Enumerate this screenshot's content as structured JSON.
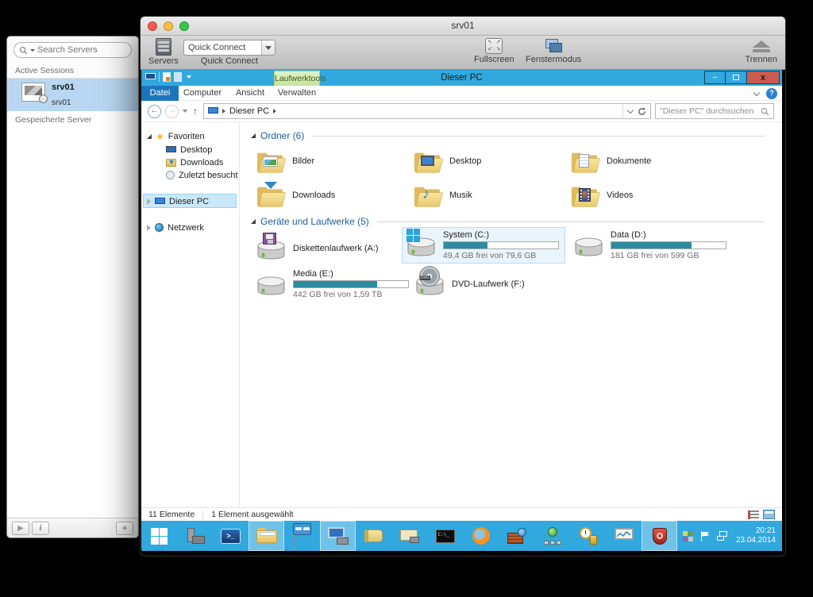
{
  "client": {
    "title": "srv01",
    "sidebar": {
      "search_placeholder": "Search Servers",
      "active_sessions_label": "Active Sessions",
      "saved_servers_label": "Gespeicherte Server",
      "session_name": "srv01",
      "session_subtitle": "srv01"
    },
    "toolbar": {
      "servers_label": "Servers",
      "quick_connect_value": "Quick Connect",
      "quick_connect_caption": "Quick Connect",
      "fullscreen_label": "Fullscreen",
      "window_mode_label": "Fenstermodus",
      "disconnect_label": "Trennen"
    }
  },
  "explorer": {
    "window_title": "Dieser PC",
    "contextual_tab": "Laufwerktools",
    "tabs": {
      "file": "Datei",
      "computer": "Computer",
      "view": "Ansicht",
      "manage": "Verwalten"
    },
    "breadcrumb_root": "Dieser PC",
    "search_placeholder": "\"Dieser PC\" durchsuchen",
    "nav": {
      "favorites": "Favoriten",
      "desktop": "Desktop",
      "downloads": "Downloads",
      "recent": "Zuletzt besucht",
      "this_pc": "Dieser PC",
      "network": "Netzwerk"
    },
    "folders_header": "Ordner (6)",
    "folders": [
      {
        "name": "Bilder"
      },
      {
        "name": "Desktop"
      },
      {
        "name": "Dokumente"
      },
      {
        "name": "Downloads"
      },
      {
        "name": "Musik"
      },
      {
        "name": "Videos"
      }
    ],
    "drives_header": "Geräte und Laufwerke (5)",
    "drives": [
      {
        "name": "Diskettenlaufwerk (A:)",
        "kind": "floppy"
      },
      {
        "name": "System (C:)",
        "free_text": "49,4 GB frei von 79,6 GB",
        "used_pct": 38,
        "kind": "system",
        "selected": true
      },
      {
        "name": "Data (D:)",
        "free_text": "181 GB frei von 599 GB",
        "used_pct": 70,
        "kind": "hdd"
      },
      {
        "name": "Media (E:)",
        "free_text": "442 GB frei von 1,59 TB",
        "used_pct": 73,
        "kind": "hdd"
      },
      {
        "name": "DVD-Laufwerk (F:)",
        "kind": "dvd"
      }
    ],
    "status": {
      "items": "11 Elemente",
      "selected": "1 Element ausgewählt"
    }
  },
  "taskbar": {
    "time": "20:21",
    "date": "23.04.2014",
    "icons": [
      "start",
      "server-manager",
      "powershell",
      "file-explorer",
      "display-settings",
      "computer-management",
      "help-book",
      "scroll-tools",
      "command-prompt",
      "firefox",
      "firewall",
      "network-tree",
      "time-service",
      "performance-monitor",
      "security-shield"
    ],
    "tray_icons": [
      "app-badge",
      "action-center-flag",
      "network-status"
    ]
  },
  "glyphs": {
    "back": "←",
    "up": "↑",
    "play": "▶",
    "info": "i",
    "add": "+",
    "help": "?",
    "minimize": "–",
    "close": "x",
    "music_note": "♪",
    "star": "★",
    "prompt": ">_",
    "cmd": "C:\\_",
    "dvd": "DVD",
    "fs_nw": "↖",
    "fs_ne": "↗",
    "fs_sw": "↙",
    "fs_se": "↘"
  },
  "colors": {
    "accent_blue": "#31a8de",
    "capacity_teal": "#2e8ba0",
    "close_red": "#cb5a50",
    "selection_blue": "#b9d7f2"
  }
}
